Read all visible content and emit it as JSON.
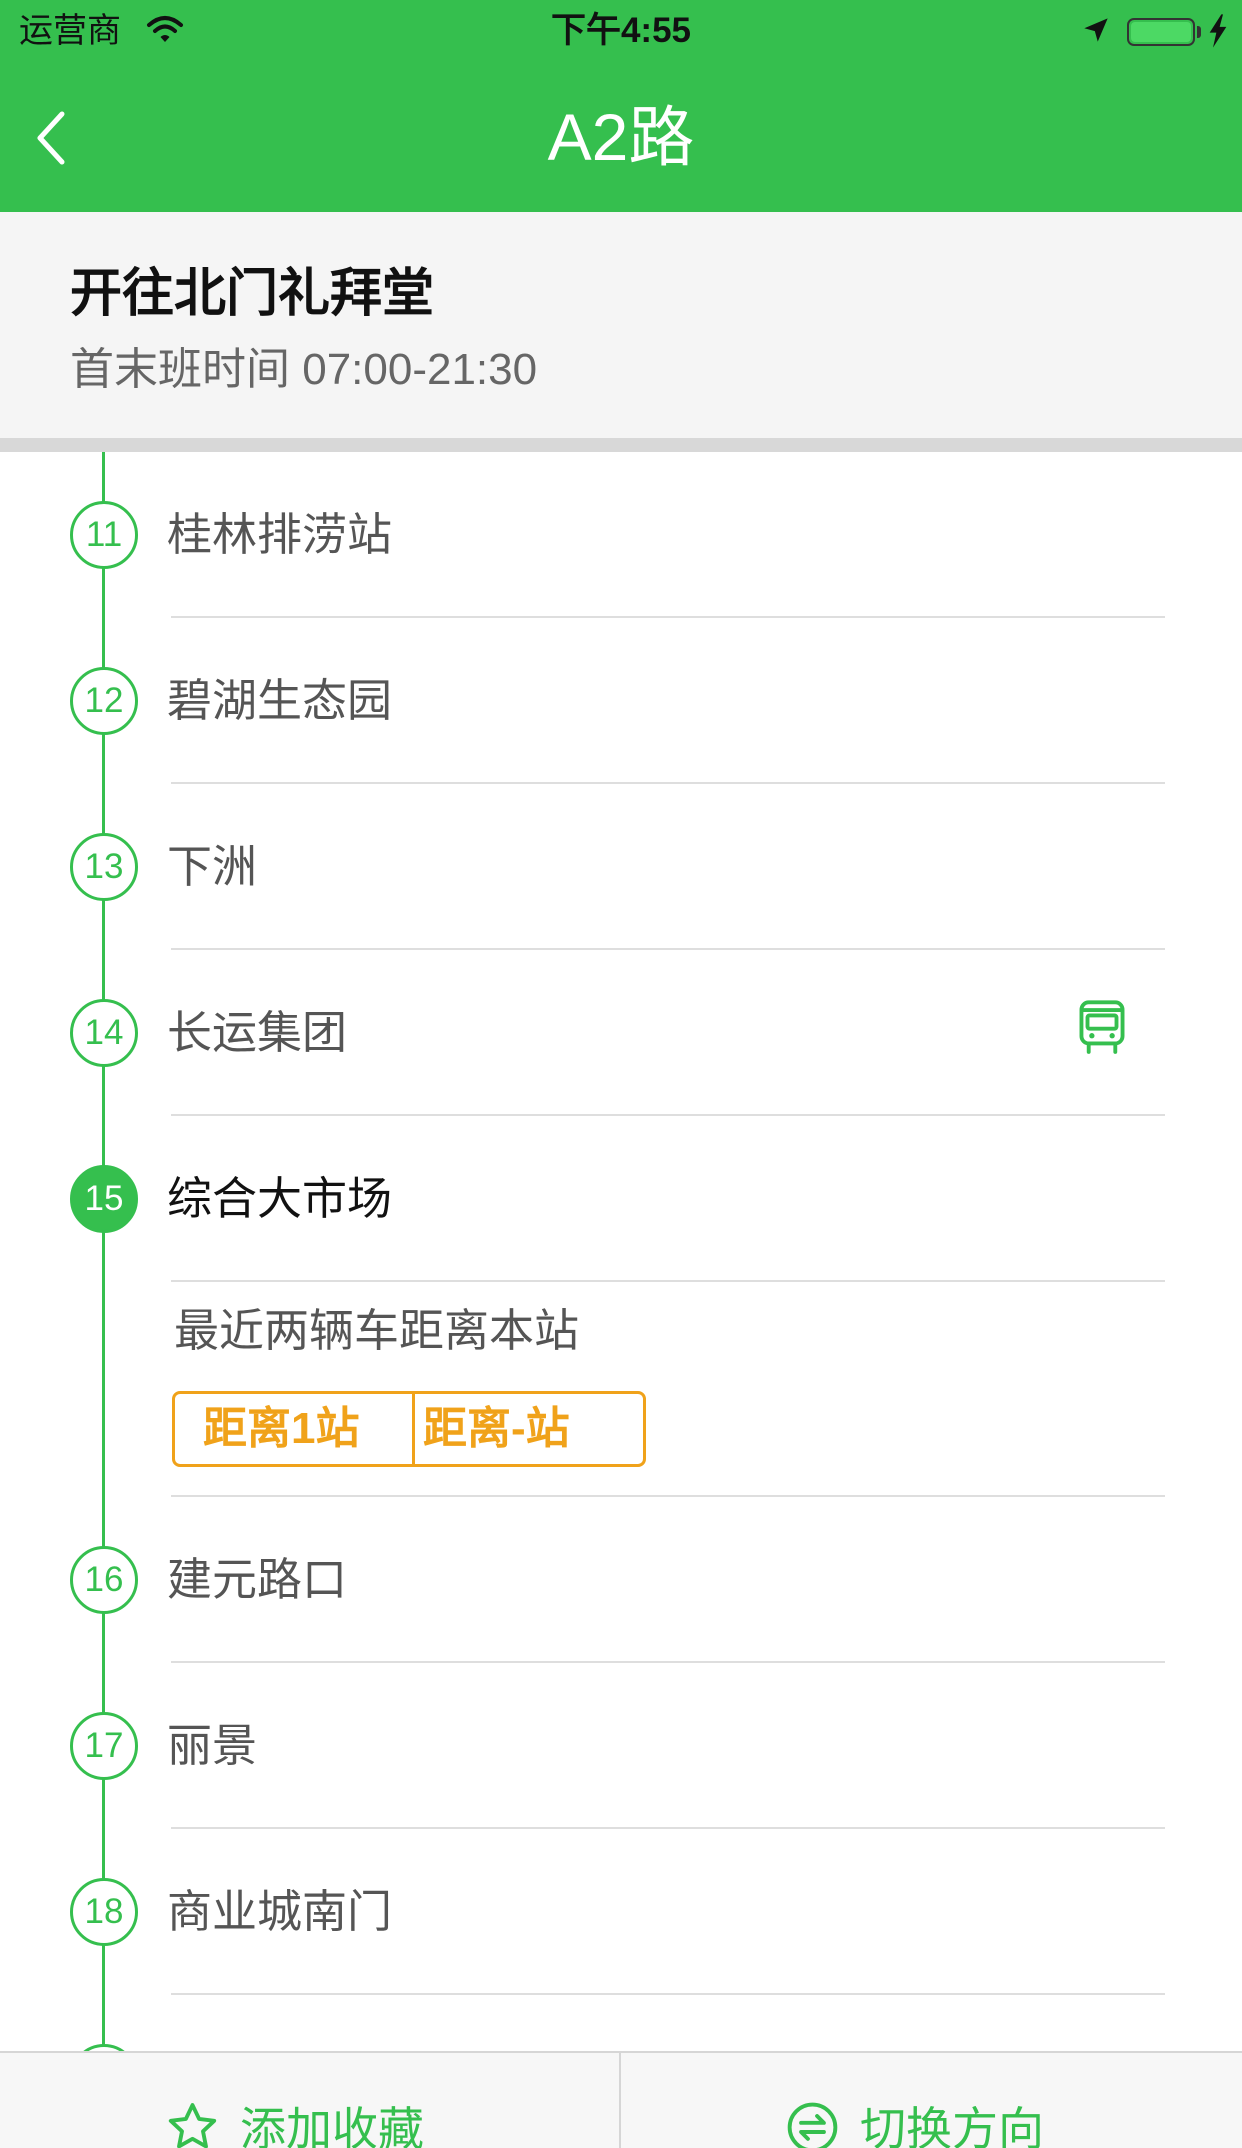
{
  "status_bar": {
    "carrier": "运营商",
    "time": "下午4:55",
    "battery_level": 1.0,
    "icons": [
      "wifi-icon",
      "location-arrow-icon",
      "battery-icon",
      "charging-bolt-icon"
    ]
  },
  "nav": {
    "title": "A2路",
    "back_icon": "chevron-left-icon"
  },
  "route": {
    "direction": "开往北门礼拜堂",
    "schedule_label": "首末班时间",
    "schedule_hours": "07:00-21:30"
  },
  "stations": [
    {
      "number": "11",
      "name": "桂林排涝站"
    },
    {
      "number": "12",
      "name": "碧湖生态园"
    },
    {
      "number": "13",
      "name": "下洲"
    },
    {
      "number": "14",
      "name": "长运集团",
      "bus_icon": "bus-icon"
    },
    {
      "number": "15",
      "name": "综合大市场",
      "current": true
    },
    {
      "number": "16",
      "name": "建元路口"
    },
    {
      "number": "17",
      "name": "丽景"
    },
    {
      "number": "18",
      "name": "商业城南门"
    }
  ],
  "arrival": {
    "label": "最近两辆车距离本站",
    "buses": [
      "距离1站",
      "距离-站"
    ]
  },
  "bottom_bar": {
    "favorite_label": "添加收藏",
    "favorite_icon": "star-icon",
    "switch_label": "切换方向",
    "switch_icon": "swap-direction-icon"
  },
  "colors": {
    "accent": "#35BF4E",
    "arrival": "#F0A21A"
  }
}
